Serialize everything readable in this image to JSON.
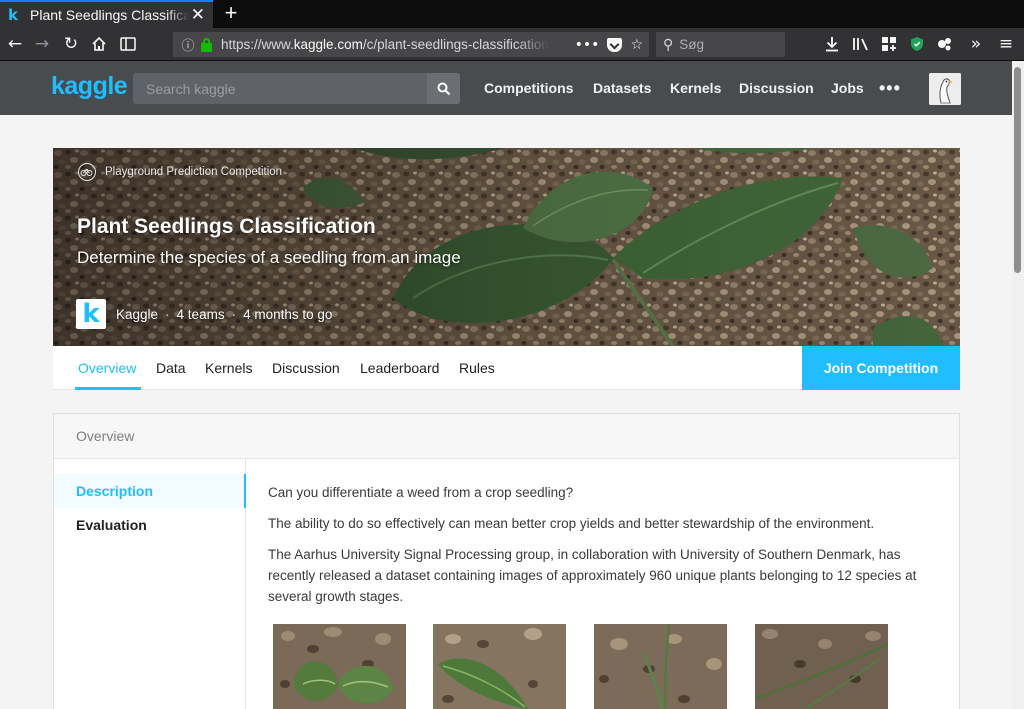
{
  "browser": {
    "tab_title": "Plant Seedlings Classification",
    "tab_favicon": "k",
    "url_scheme": "https://www.",
    "url_host": "kaggle.com",
    "url_path": "/c/plant-seedlings-classification",
    "search_placeholder": "Søg"
  },
  "kaggle_header": {
    "logo": "kaggle",
    "search_placeholder": "Search kaggle",
    "nav": [
      "Competitions",
      "Datasets",
      "Kernels",
      "Discussion",
      "Jobs"
    ],
    "more": "•••"
  },
  "competition": {
    "category": "Playground Prediction Competition",
    "title": "Plant Seedlings Classification",
    "subtitle": "Determine the species of a seedling from an image",
    "host": "Kaggle",
    "teams": "4 teams",
    "deadline": "4 months to go",
    "tabs": [
      "Overview",
      "Data",
      "Kernels",
      "Discussion",
      "Leaderboard",
      "Rules"
    ],
    "active_tab": "Overview",
    "join_label": "Join Competition"
  },
  "overview": {
    "header": "Overview",
    "sidebar": [
      "Description",
      "Evaluation"
    ],
    "paragraphs": [
      "Can you differentiate a weed from a crop seedling?",
      "The ability to do so effectively can mean better crop yields and better stewardship of the environment.",
      "The Aarhus University Signal Processing group, in collaboration with University of Southern Denmark, has recently released a dataset containing images of approximately 960 unique plants belonging to 12 species at several growth stages."
    ]
  },
  "colors": {
    "kaggle_blue": "#20beff",
    "header_bg": "#494c4f",
    "browser_chrome": "#323234"
  }
}
